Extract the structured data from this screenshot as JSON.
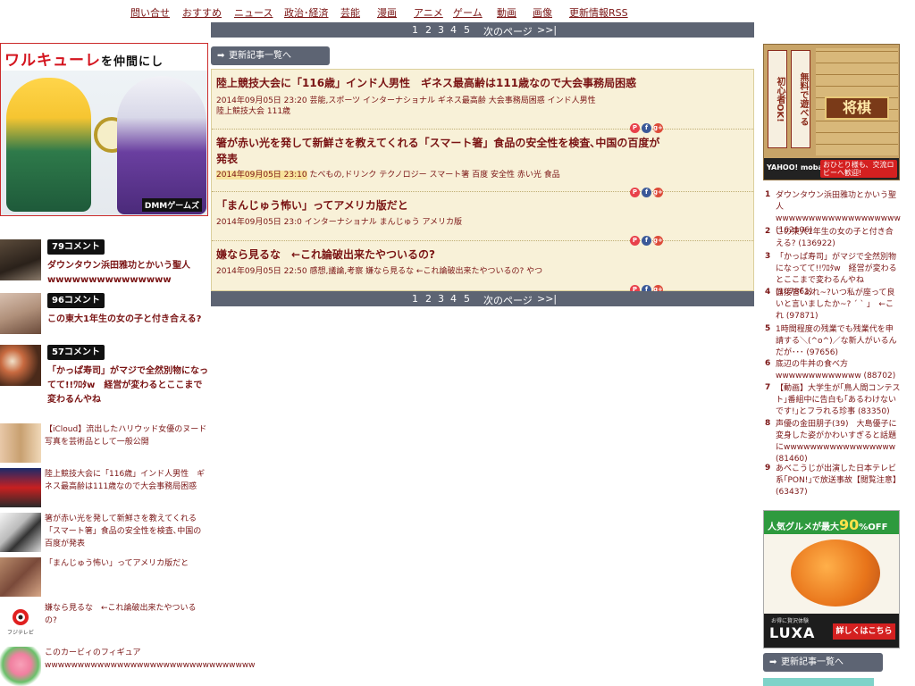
{
  "nav": {
    "items": [
      "問い合せ",
      "おすすめ",
      "ニュース",
      "政治･経済",
      "芸能",
      "漫画",
      "アニメ",
      "ゲーム",
      "動画",
      "画像",
      "更新情報RSS"
    ]
  },
  "pager": {
    "pages": [
      "1",
      "2",
      "3",
      "4",
      "5"
    ],
    "next_label": "次のページ",
    "last_label": ">>|"
  },
  "list_button_label": "更新記事一覧へ",
  "ad_left": {
    "title_main": "ワルキューレ",
    "title_rest": "を仲間にし",
    "logo": "DMMゲームズ"
  },
  "ranking_left": [
    {
      "comments": "79コメント",
      "title": "ダウンタウン浜田雅功とかいう聖人wwwwwwwwwwwwwww"
    },
    {
      "comments": "96コメント",
      "title": "この東大1年生の女の子と付き合える?"
    },
    {
      "comments": "57コメント",
      "title": "「かっぱ寿司」がマジで全然別物になってて!!ﾜﾛﾀw　経営が変わるとここまで変わるんやね"
    }
  ],
  "side_list": [
    {
      "title": "【iCloud】流出したハリウッド女優のヌード写真を芸術品として一般公開"
    },
    {
      "title": "陸上競技大会に「116歳」インド人男性　ギネス最高齢は111歳なので大会事務局困惑"
    },
    {
      "title": "箸が赤い光を発して新鮮さを教えてくれる「スマート箸」食品の安全性を検査､中国の百度が発表"
    },
    {
      "title": "「まんじゅう怖い」ってアメリカ版だと"
    },
    {
      "title": "嫌なら見るな　←これ論破出来たやついるの?"
    },
    {
      "title": "このカービィのフィギュアwwwwwwwwwwwwwwwwwwwwwwwwwwwwwwww"
    }
  ],
  "side_thumb_label": "フジテレビ",
  "articles": [
    {
      "title": "陸上競技大会に「116歳」インド人男性　ギネス最高齢は111歳なので大会事務局困惑",
      "date": "2014年09月05日 23:20",
      "tags": "芸能,スポーツ インターナショナル ギネス最高齢 大会事務局困惑 インド人男性",
      "tags2": "陸上競技大会 111歳"
    },
    {
      "title": "箸が赤い光を発して新鮮さを教えてくれる「スマート箸」食品の安全性を検査､中国の百度が発表",
      "date": "2014年09月05日 23:10",
      "tags": "たべもの,ドリンク テクノロジー スマート箸 百度 安全性 赤い光 食品",
      "tags2": ""
    },
    {
      "title": "「まんじゅう怖い」ってアメリカ版だと",
      "date": "2014年09月05日 23:0",
      "tags": "インターナショナル まんじゅう アメリカ版",
      "tags2": ""
    },
    {
      "title": "嫌なら見るな　←これ論破出来たやついるの?",
      "date": "2014年09月05日 22:50",
      "tags": "感想,議論,考察 嫌なら見るな ←これ論破出来たやついるの? やつ",
      "tags2": ""
    }
  ],
  "share": {
    "pocket": "P",
    "facebook": "f",
    "gplus": "g+"
  },
  "ad_shogi": {
    "vert1": "初心者OK!",
    "vert2": "無料で遊べる",
    "plate": "将棋",
    "logo": "YAHOO! mobage",
    "cta": "おひとり様も、交流ロビーへ歓迎!"
  },
  "ranking_right": [
    {
      "num": "1",
      "text": "ダウンタウン浜田雅功とかいう聖人wwwwwwwwwwwwwwwwwww (162106)"
    },
    {
      "num": "2",
      "text": "この東大1年生の女の子と付き合える? (136922)"
    },
    {
      "num": "3",
      "text": "「かっぱ寿司」がマジで全然別物になってて!!ﾜﾛﾀw　経営が変わるとここまで変わるんやね (107861)"
    },
    {
      "num": "4",
      "text": "面接官｢あれ~?いつ私が座って良いと言いましたか~? ´ ` ｣　←これ (97871)"
    },
    {
      "num": "5",
      "text": "1時間程度の残業でも残業代を申請する＼(^o^)／な新人がいるんだが･･･ (97656)"
    },
    {
      "num": "6",
      "text": "底辺の牛丼の食べ方wwwwwwwwwwwww (88702)"
    },
    {
      "num": "7",
      "text": "【動画】大学生が｢鳥人間コンテスト｣番組中に告白も｢あるわけないです!｣とフラれる珍事 (83350)"
    },
    {
      "num": "8",
      "text": "声優の金田朋子(39)　大島優子に変身した姿がかわいすぎると話題にwwwwwwwwwwwwwwwww (81460)"
    },
    {
      "num": "9",
      "text": "あべこうじが出演した日本テレビ系｢PON!｣で放送事故【閲覧注意】 (63437)"
    }
  ],
  "ad_luxa": {
    "banner_pre": "人気グルメが最大",
    "banner_big": "90",
    "banner_post": "%OFF",
    "sub": "お得に贅沢体験",
    "logo": "LUXA",
    "cta": "詳しくはこちら"
  }
}
